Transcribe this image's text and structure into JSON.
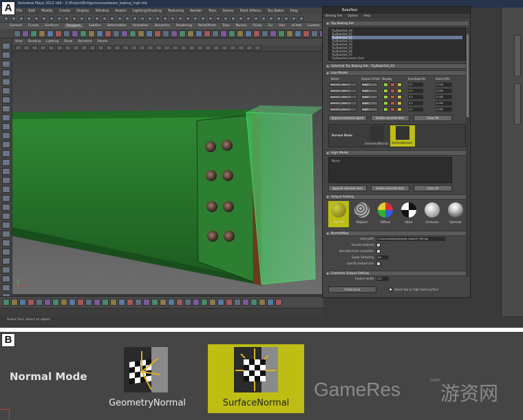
{
  "panel_a": {
    "letter": "A",
    "maya_title": "Autodesk Maya 2012 x64 - Z:/Project/Bridge/scenes/beam_baking_high.mb",
    "menubar": [
      "File",
      "Edit",
      "Modify",
      "Create",
      "Display",
      "Window",
      "Assets",
      "Lighting/Shading",
      "Texturing",
      "Render",
      "Toon",
      "Stereo",
      "Paint Effects",
      "Toy Baker",
      "Help"
    ],
    "shelf_tabs": [
      "General",
      "Curves",
      "Surfaces",
      "Polygons",
      "Subdivs",
      "Deformation",
      "Animation",
      "Dynamics",
      "Rendering",
      "PaintEffects",
      "Toon",
      "Muscle",
      "Fluids",
      "Fur",
      "Hair",
      "nCloth",
      "Custom"
    ],
    "active_shelf_tab": "Polygons",
    "viewport_menu": [
      "View",
      "Shading",
      "Lighting",
      "Show",
      "Renderer",
      "Panels"
    ],
    "help_line": "Select Tool: select an object",
    "baking_tool": {
      "title": "BakeTool",
      "menu": [
        "Baking Set",
        "Option",
        "Help"
      ],
      "sections": {
        "baking_set": "Toy Baking Set",
        "selected_set": "Selected Toy Baking Set : ToyBakeSet_04",
        "low_model": "Low Model",
        "high_model": "High Model",
        "output_setting": "Output Setting",
        "normal_map": "NormalMap",
        "common_output": "Common Output Setting"
      },
      "baking_set_list": [
        "ToyBakeSet_00",
        "ToyBakeSet_01",
        "ToyBakeSet_02",
        "ToyBakeSet_03",
        "ToyBakeSet_04",
        "ToyBakeSet_05",
        "ToyBakeSet_06",
        "ToyBakeSet_07",
        "ToyBakeSet_beam_final"
      ],
      "low_columns": [
        "Name",
        "Output UVset",
        "Display",
        "Envelope(%)",
        "Search(%)"
      ],
      "low_rows": [
        "beam01_steel_1",
        "beam01_steel_2",
        "beam01_steel_3",
        "beam01_steel_4",
        "beam01_steel_5"
      ],
      "low_uv": "map1",
      "low_values": [
        "0.0",
        "0.0",
        "0.0",
        "0.0",
        "0.0"
      ],
      "low_search": [
        "0.000",
        "0.000",
        "0.000",
        "0.000",
        "0.000"
      ],
      "low_buttons": [
        "Append selected object",
        "Delete selected item",
        "Clear All"
      ],
      "normal_mode_small": "Normal Mode",
      "mode_small": [
        "GeometryNormal",
        "SurfaceNormal"
      ],
      "high_header": "Name",
      "high_buttons": [
        "Append selected item",
        "Delete selected item",
        "Clear All"
      ],
      "shaders": [
        "Normal",
        "Displace",
        "Diffuse",
        "Alpha",
        "Occlusion",
        "Specular"
      ],
      "normal_map_fields": [
        {
          "label": "save path",
          "value": "C:/Users/images/toybake_beam01_NM.tga"
        },
        {
          "label": "include material",
          "value": ""
        },
        {
          "label": "low bake error correction",
          "value": ""
        },
        {
          "label": "Super Sampling",
          "value": "4x4"
        },
        {
          "label": "specify texture size",
          "value": ""
        }
      ],
      "common_fields": [
        {
          "label": "texture width",
          "value": "512"
        }
      ],
      "check_button": "Check Error",
      "check_option": "Select low or high mesh surface"
    }
  },
  "panel_b": {
    "letter": "B",
    "normal_mode_label": "Normal Mode",
    "options": [
      {
        "label": "GeometryNormal",
        "selected": false
      },
      {
        "label": "SurfaceNormal",
        "selected": true
      }
    ],
    "watermark": "GameRes",
    "watermark_sub": "com",
    "watermark_cn": "游资网"
  },
  "colors": {
    "selected_yellow": "#bdbd14",
    "beam_green": "#2a7a2e",
    "maya_panel": "#454545"
  }
}
